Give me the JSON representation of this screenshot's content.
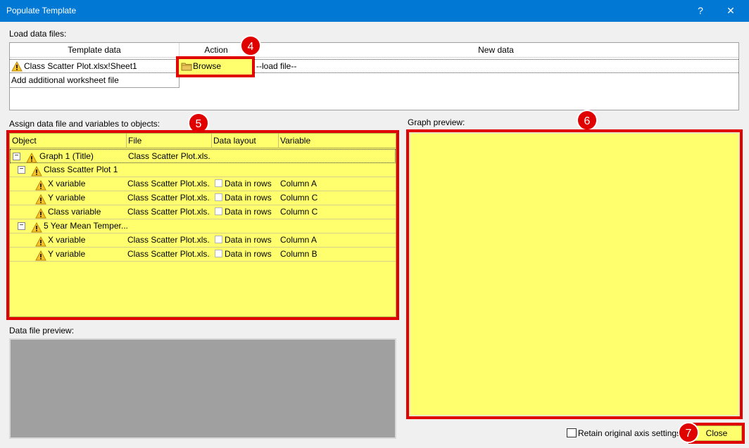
{
  "window": {
    "title": "Populate Template",
    "help": "?",
    "close": "✕"
  },
  "load": {
    "label": "Load data files:",
    "headers": {
      "template": "Template data",
      "action": "Action",
      "new": "New data"
    },
    "row1": {
      "template": "Class Scatter Plot.xlsx!Sheet1",
      "action": "Browse",
      "new": "--load file--"
    },
    "row2": {
      "template": "Add additional worksheet file"
    }
  },
  "assign": {
    "label": "Assign data file and variables to objects:",
    "headers": {
      "object": "Object",
      "file": "File",
      "layout": "Data layout",
      "variable": "Variable"
    },
    "rows": [
      {
        "object": "Graph 1 (Title)",
        "file": "Class Scatter Plot.xls...",
        "layout": "",
        "variable": ""
      },
      {
        "object": "Class Scatter Plot 1",
        "file": "",
        "layout": "",
        "variable": ""
      },
      {
        "object": "X variable",
        "file": "Class Scatter Plot.xls...",
        "layout": "Data in rows",
        "variable": "Column A"
      },
      {
        "object": "Y variable",
        "file": "Class Scatter Plot.xls...",
        "layout": "Data in rows",
        "variable": "Column C"
      },
      {
        "object": "Class variable",
        "file": "Class Scatter Plot.xls...",
        "layout": "Data in rows",
        "variable": "Column C"
      },
      {
        "object": "5 Year Mean Temper...",
        "file": "",
        "layout": "",
        "variable": ""
      },
      {
        "object": "X variable",
        "file": "Class Scatter Plot.xls...",
        "layout": "Data in rows",
        "variable": "Column A"
      },
      {
        "object": "Y variable",
        "file": "Class Scatter Plot.xls...",
        "layout": "Data in rows",
        "variable": "Column B"
      }
    ]
  },
  "preview": {
    "data_label": "Data file preview:",
    "graph_label": "Graph preview:"
  },
  "footer": {
    "retain_label": "Retain original axis settings",
    "close_label": "Close"
  },
  "badges": {
    "b4": "4",
    "b5": "5",
    "b6": "6",
    "b7": "7"
  },
  "colors": {
    "titlebar": "#0078d4",
    "highlight": "#ffff6e",
    "annotation": "#e00000"
  }
}
